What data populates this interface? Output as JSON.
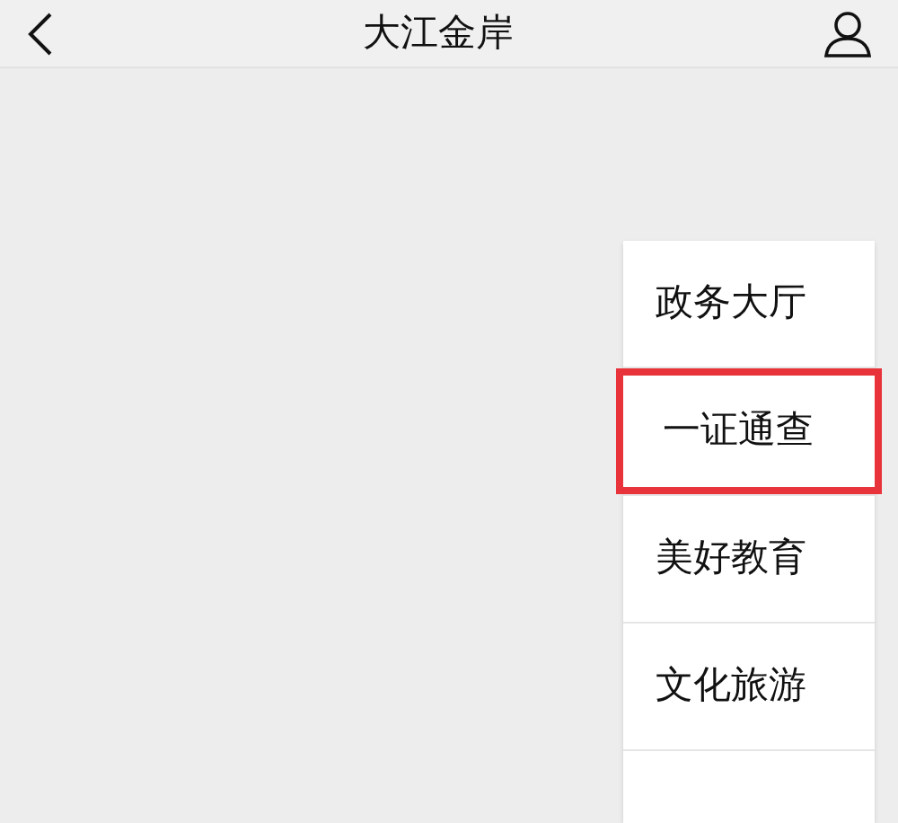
{
  "header": {
    "title": "大江金岸"
  },
  "menu": {
    "items": [
      {
        "label": "政务大厅",
        "highlighted": false
      },
      {
        "label": "一证通查",
        "highlighted": true
      },
      {
        "label": "美好教育",
        "highlighted": false
      },
      {
        "label": "文化旅游",
        "highlighted": false
      }
    ]
  }
}
